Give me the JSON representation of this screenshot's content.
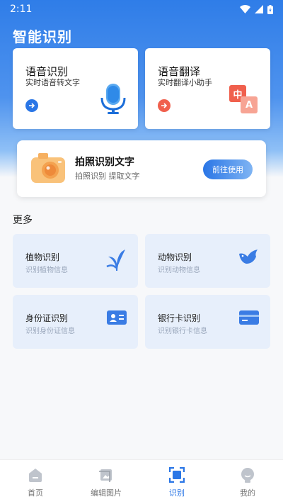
{
  "status": {
    "time": "2:11"
  },
  "header": {
    "title": "智能识别"
  },
  "cards": [
    {
      "title": "语音识别",
      "subtitle": "实时语音转文字",
      "accent": "#2a76e6"
    },
    {
      "title": "语音翻译",
      "subtitle": "实时翻译小助手",
      "accent": "#f0604d"
    }
  ],
  "translate_icon": {
    "zh": "中",
    "en": "A"
  },
  "photo": {
    "title": "拍照识别文字",
    "subtitle": "拍照识别 提取文字",
    "button": "前往使用"
  },
  "more": {
    "title": "更多",
    "items": [
      {
        "title": "植物识别",
        "subtitle": "识别植物信息",
        "icon": "plant-icon"
      },
      {
        "title": "动物识别",
        "subtitle": "识别动物信息",
        "icon": "bird-icon"
      },
      {
        "title": "身份证识别",
        "subtitle": "识别身份证信息",
        "icon": "id-card-icon"
      },
      {
        "title": "银行卡识别",
        "subtitle": "识别银行卡信息",
        "icon": "bank-card-icon"
      }
    ]
  },
  "tabs": [
    {
      "label": "首页",
      "icon": "home-icon"
    },
    {
      "label": "编辑图片",
      "icon": "crop-icon"
    },
    {
      "label": "识别",
      "icon": "scan-icon",
      "active": true
    },
    {
      "label": "我的",
      "icon": "profile-icon"
    }
  ]
}
